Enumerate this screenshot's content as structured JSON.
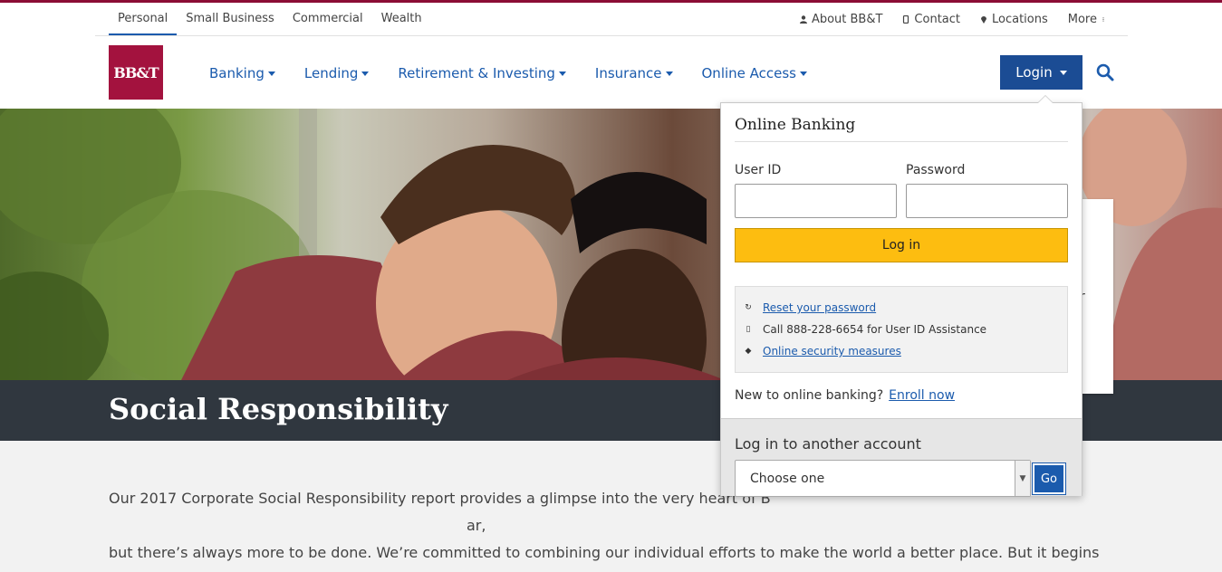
{
  "segments": [
    "Personal",
    "Small Business",
    "Commercial",
    "Wealth"
  ],
  "utility": {
    "about": "About BB&T",
    "contact": "Contact",
    "locations": "Locations",
    "more": "More"
  },
  "brand": {
    "logo": "BB&T",
    "color": "#a3123e"
  },
  "nav": [
    "Banking",
    "Lending",
    "Retirement & Investing",
    "Insurance",
    "Online Access"
  ],
  "login_button": "Login",
  "icons": {
    "search": "search-icon",
    "user": "user-icon",
    "phone": "phone-icon",
    "pin": "location-pin-icon",
    "more": "kebab-icon"
  },
  "hero": {
    "title": "Social Responsibility"
  },
  "content": {
    "paragraph": "Our 2017 Corporate Social Responsibility report provides a glimpse into the very heart of B",
    "paragraph_end": "ar,",
    "paragraph_2": "but there’s always more to be done. We’re committed to combining our individual efforts to make the world a better place. But it begins with one – one day at a time, one person at a time, one interaction at a time."
  },
  "side_card_letter": "r",
  "login_panel": {
    "title": "Online Banking",
    "user_id_label": "User ID",
    "password_label": "Password",
    "user_id_value": "",
    "password_value": "",
    "submit": "Log in",
    "reset_password": "Reset your password",
    "call_text": "Call 888-228-6654 for User ID Assistance",
    "security": "Online security measures",
    "new_text": "New to online banking?",
    "enroll": "Enroll now",
    "another_account": "Log in to another account",
    "select_value": "Choose one",
    "go": "Go"
  },
  "colors": {
    "accent": "#1b5bad",
    "login_bg": "#1b4c94",
    "submit": "#fdbd10",
    "band": "#30373f"
  }
}
